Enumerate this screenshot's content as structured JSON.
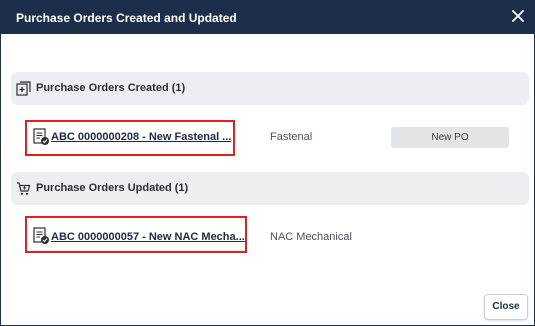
{
  "dialog": {
    "title": "Purchase Orders Created and Updated",
    "close_icon": "close-icon",
    "close_label": "Close"
  },
  "created": {
    "header": "Purchase Orders Created (1)",
    "icon": "add-document-icon",
    "items": [
      {
        "link": "ABC 0000000208 - New Fastenal ...",
        "vendor": "Fastenal",
        "badge": "New PO",
        "icon": "purchase-order-icon"
      }
    ]
  },
  "updated": {
    "header": "Purchase Orders Updated (1)",
    "icon": "cart-icon",
    "items": [
      {
        "link": "ABC 0000000057 - New NAC Mecha...",
        "vendor": "NAC Mechanical",
        "icon": "purchase-order-icon"
      }
    ]
  },
  "colors": {
    "titlebar": "#1c2e4a",
    "section_bg": "#eceef1",
    "highlight": "#e11f1f",
    "badge_bg": "#e3e4e6"
  }
}
